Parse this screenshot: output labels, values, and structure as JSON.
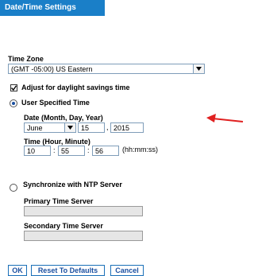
{
  "header": {
    "title": "Date/Time Settings"
  },
  "timezone": {
    "label": "Time Zone",
    "selected": "(GMT -05:00) US Eastern"
  },
  "dst": {
    "label": "Adjust for daylight savings time",
    "checked": true
  },
  "user_time": {
    "label": "User Specified Time",
    "selected": true,
    "date_label": "Date (Month, Day, Year)",
    "month": "June",
    "day": "15",
    "year": "2015",
    "date_sep": ",",
    "time_label": "Time (Hour, Minute)",
    "hour": "10",
    "minute": "55",
    "second": "56",
    "time_sep": ":",
    "time_format": "(hh:mm:ss)"
  },
  "ntp": {
    "label": "Synchronize with NTP Server",
    "selected": false,
    "primary_label": "Primary Time Server",
    "primary_value": "",
    "secondary_label": "Secondary Time Server",
    "secondary_value": ""
  },
  "buttons": {
    "ok": "OK",
    "reset": "Reset To Defaults",
    "cancel": "Cancel"
  },
  "annotation": {
    "arrow_color": "#e02020"
  }
}
